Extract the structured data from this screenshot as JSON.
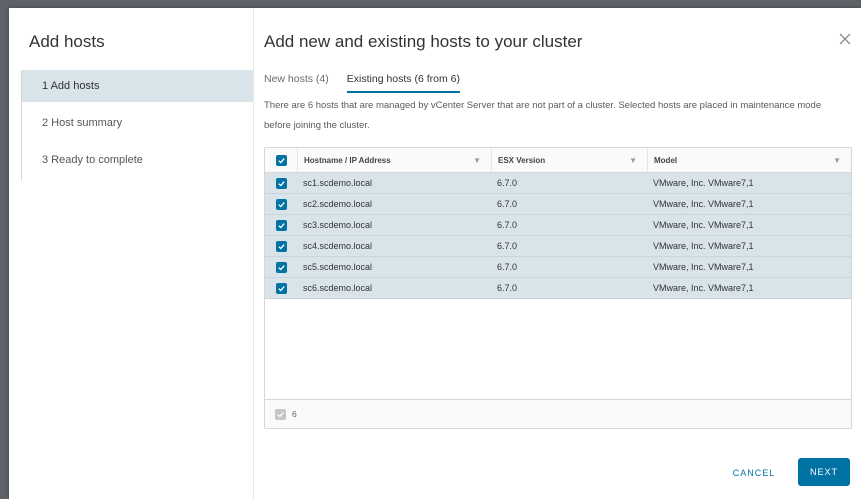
{
  "nav": {
    "title": "Add hosts",
    "steps": [
      {
        "label": "1  Add hosts"
      },
      {
        "label": "2  Host summary"
      },
      {
        "label": "3  Ready to complete"
      }
    ]
  },
  "header": {
    "title": "Add new and existing hosts to your cluster",
    "close_icon": "close-icon"
  },
  "tabs": [
    {
      "label": "New hosts (4)"
    },
    {
      "label": "Existing hosts (6 from 6)"
    }
  ],
  "description": "There are 6 hosts that are managed by vCenter Server that are not part of a cluster. Selected hosts are placed in maintenance mode before joining the cluster.",
  "grid": {
    "columns": [
      "Hostname / IP Address",
      "ESX Version",
      "Model"
    ],
    "rows": [
      {
        "hostname": "sc1.scdemo.local",
        "esx": "6.7.0",
        "model": "VMware, Inc. VMware7,1"
      },
      {
        "hostname": "sc2.scdemo.local",
        "esx": "6.7.0",
        "model": "VMware, Inc. VMware7,1"
      },
      {
        "hostname": "sc3.scdemo.local",
        "esx": "6.7.0",
        "model": "VMware, Inc. VMware7,1"
      },
      {
        "hostname": "sc4.scdemo.local",
        "esx": "6.7.0",
        "model": "VMware, Inc. VMware7,1"
      },
      {
        "hostname": "sc5.scdemo.local",
        "esx": "6.7.0",
        "model": "VMware, Inc. VMware7,1"
      },
      {
        "hostname": "sc6.scdemo.local",
        "esx": "6.7.0",
        "model": "VMware, Inc. VMware7,1"
      }
    ],
    "footer_count": "6"
  },
  "buttons": {
    "cancel": "CANCEL",
    "next": "NEXT"
  },
  "colors": {
    "accent": "#0072a3",
    "selected_row": "#d9e4ea"
  }
}
